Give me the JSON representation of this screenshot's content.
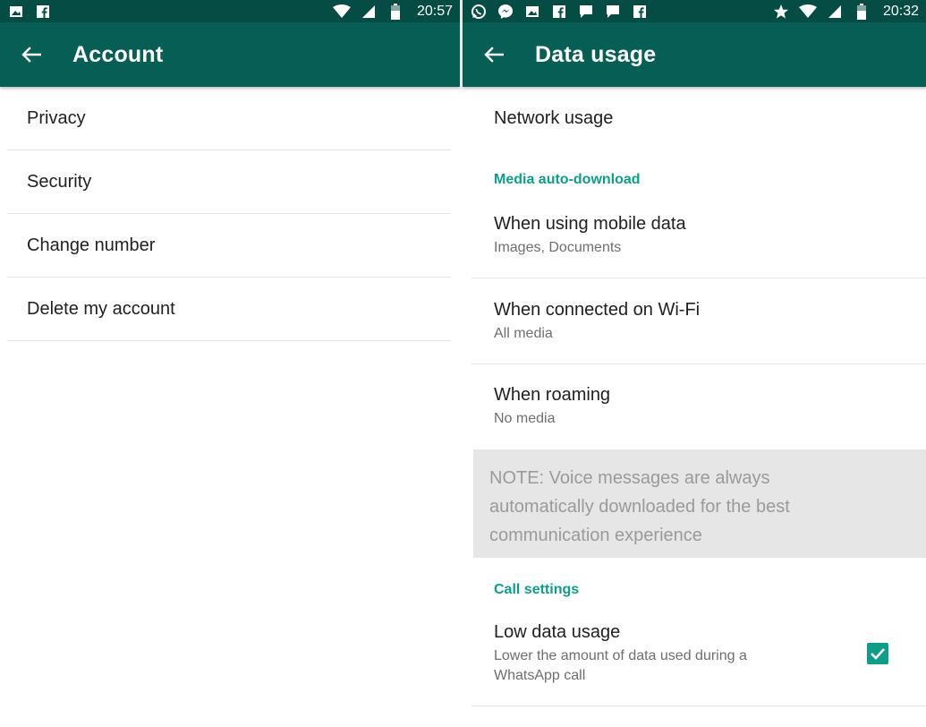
{
  "left": {
    "status_bar": {
      "icons": [
        "image-notification-icon",
        "facebook-notification-icon"
      ],
      "right_icons": [
        "wifi-icon",
        "signal-icon",
        "battery-icon"
      ],
      "time": "20:57"
    },
    "toolbar": {
      "title": "Account",
      "back_icon": "arrow-back-icon"
    },
    "items": [
      {
        "label": "Privacy"
      },
      {
        "label": "Security"
      },
      {
        "label": "Change number"
      },
      {
        "label": "Delete my account"
      }
    ]
  },
  "right": {
    "status_bar": {
      "icons": [
        "whatsapp-notification-icon",
        "messenger-notification-icon",
        "image-notification-icon",
        "facebook-notification-icon",
        "chat-notification-icon",
        "chat-notification-icon",
        "facebook-notification-icon"
      ],
      "right_icons": [
        "star-icon",
        "wifi-icon",
        "signal-icon",
        "battery-icon"
      ],
      "time": "20:32"
    },
    "toolbar": {
      "title": "Data usage",
      "back_icon": "arrow-back-icon"
    },
    "network_usage": {
      "label": "Network usage"
    },
    "media_section": {
      "header": "Media auto-download",
      "items": [
        {
          "title": "When using mobile data",
          "subtitle": "Images, Documents"
        },
        {
          "title": "When connected on Wi-Fi",
          "subtitle": "All media"
        },
        {
          "title": "When roaming",
          "subtitle": "No media"
        }
      ]
    },
    "note": {
      "line1": "NOTE: Voice messages are always",
      "line2": "automatically downloaded for the best",
      "line3": "communication experience"
    },
    "call_section": {
      "header": "Call settings",
      "low_data": {
        "title": "Low data usage",
        "subtitle_line1": "Lower the amount of data used during a",
        "subtitle_line2": "WhatsApp call",
        "checked": true
      }
    }
  },
  "colors": {
    "status_bar": "#054d44",
    "toolbar": "#075e54",
    "accent": "#0f9d8a",
    "note_bg": "#e6e6e6"
  }
}
